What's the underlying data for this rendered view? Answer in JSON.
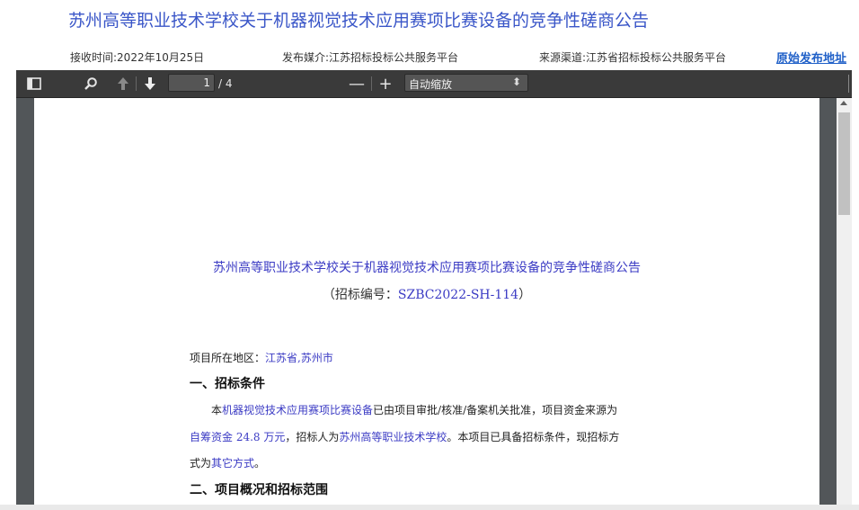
{
  "header": {
    "title": "苏州高等职业技术学校关于机器视觉技术应用赛项比赛设备的竞争性磋商公告",
    "received": "接收时间:2022年10月25日",
    "media": "发布媒介:江苏招标投标公共服务平台",
    "source": "来源渠道:江苏省招标投标公共服务平台",
    "origin_link": "原始发布地址"
  },
  "toolbar": {
    "page_current": "1",
    "page_count": "/ 4",
    "zoom_out": "—",
    "zoom_in": "+",
    "zoom_value": "自动缩放",
    "icons": [
      "sidebar-toggle-icon",
      "search-icon",
      "arrow-up-icon",
      "arrow-down-icon",
      "chevron-updown-icon"
    ]
  },
  "document": {
    "title": "苏州高等职业技术学校关于机器视觉技术应用赛项比赛设备的竞争性磋商公告",
    "code_prefix": "（招标编号：",
    "code": "SZBC2022-SH-114",
    "code_suffix": "）",
    "region_label": "项目所在地区：",
    "region_value": "江苏省,苏州市",
    "section1": "一、招标条件",
    "p1_indent": "本",
    "p1_project": "机器视觉技术应用赛项比赛设备",
    "p1_rest": "已由项目审批/核准/备案机关批准，项目资金来源为",
    "p2_fund": "自筹资金 24.8 万元",
    "p2_mid": "，招标人为",
    "p2_org": "苏州高等职业技术学校",
    "p2_rest": "。本项目已具备招标条件，现招标方",
    "p3_lead": "式为",
    "p3_method": "其它方式",
    "p3_end": "。",
    "section2": "二、项目概况和招标范围"
  },
  "colors": {
    "title_blue": "#3a56c8",
    "link_blue": "#2060c8",
    "doc_highlight": "#3b3bc4",
    "toolbar_bg": "#3a3a3a",
    "viewer_bg": "#525659"
  }
}
